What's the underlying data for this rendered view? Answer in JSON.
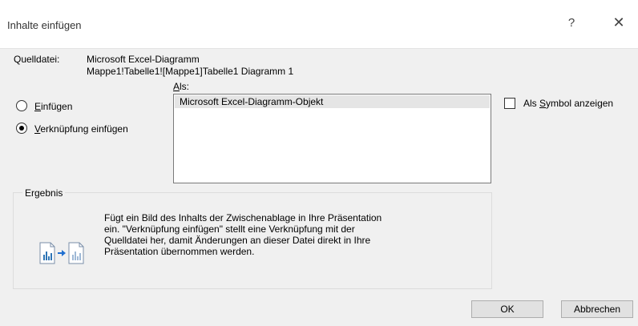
{
  "dialog": {
    "title": "Inhalte einfügen",
    "help_symbol": "?",
    "close_symbol": "✕"
  },
  "source": {
    "label": "Quelldatei:",
    "name": "Microsoft Excel-Diagramm",
    "path": "Mappe1!Tabelle1![Mappe1]Tabelle1 Diagramm 1"
  },
  "als": {
    "label_underlined": "A",
    "label_rest": "ls:"
  },
  "options": {
    "paste": {
      "underlined": "E",
      "rest": "infügen",
      "checked": false
    },
    "paste_link": {
      "underlined": "V",
      "rest": "erknüpfung einfügen",
      "checked": true
    }
  },
  "listbox": {
    "items": [
      "Microsoft Excel-Diagramm-Objekt"
    ]
  },
  "display_as_icon": {
    "prefix": "Als ",
    "underlined": "S",
    "rest": "ymbol anzeigen",
    "checked": false
  },
  "result": {
    "title": "Ergebnis",
    "icon": "paste-link-chart-icon",
    "lines": [
      "Fügt ein Bild des Inhalts der Zwischenablage in Ihre Präsentation",
      "ein. \"Verknüpfung einfügen\" stellt eine Verknüpfung mit der",
      "Quelldatei her, damit Änderungen an dieser Datei direkt in Ihre",
      "Präsentation übernommen werden."
    ]
  },
  "buttons": {
    "ok": "OK",
    "cancel": "Abbrechen"
  }
}
